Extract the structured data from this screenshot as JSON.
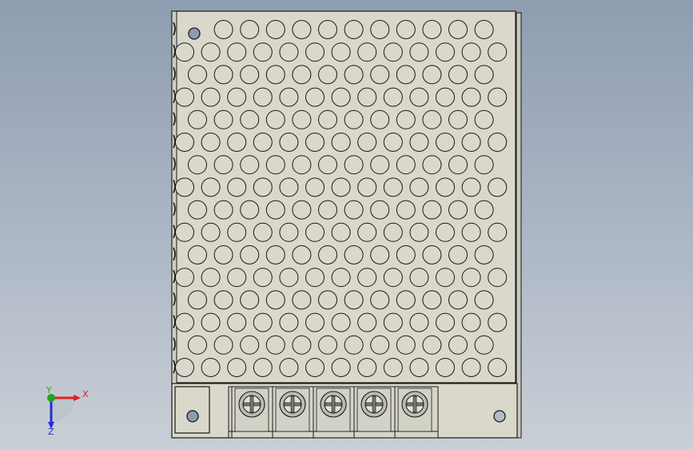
{
  "viewport": {
    "background_top": "#8f9db1",
    "background_bottom": "#c9cfd6"
  },
  "model": {
    "name": "power-supply-unit",
    "body_color": "#d9d8cb",
    "outline_color": "#1a1a1a",
    "vent_hole_rows": 16,
    "vent_hole_cols": 12,
    "terminal_count": 5,
    "terminal_color": "#bdbcb3"
  },
  "triad": {
    "x_label": "X",
    "y_label": "Y",
    "z_label": "Z",
    "x_color": "#e32020",
    "y_color": "#1fa81f",
    "z_color": "#2030d8"
  }
}
